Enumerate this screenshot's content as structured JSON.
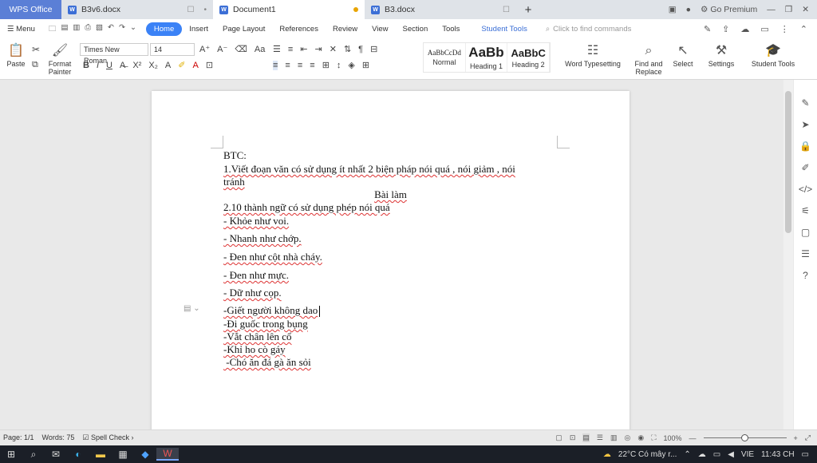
{
  "titlebar": {
    "app_tab": "WPS Office",
    "tabs": [
      {
        "label": "B3v6.docx"
      },
      {
        "label": "Document1"
      },
      {
        "label": "B3.docx"
      }
    ],
    "new_tab": "+",
    "go_premium": "Go Premium"
  },
  "ribbon_tabs": {
    "menu": "Menu",
    "items": [
      "Home",
      "Insert",
      "Page Layout",
      "References",
      "Review",
      "View",
      "Section",
      "Tools"
    ],
    "student_tools": "Student Tools",
    "search_placeholder": "Click to find commands"
  },
  "ribbon": {
    "paste": "Paste",
    "format_painter_1": "Format",
    "format_painter_2": "Painter",
    "font_name": "Times New Roman",
    "font_size": "14",
    "styles": [
      {
        "preview": "AaBbCcDd",
        "name": "Normal"
      },
      {
        "preview": "AaBb",
        "name": "Heading 1"
      },
      {
        "preview": "AaBbC",
        "name": "Heading 2"
      }
    ],
    "word_typesetting": "Word Typesetting",
    "find_replace_1": "Find and",
    "find_replace_2": "Replace",
    "select": "Select",
    "settings": "Settings",
    "student_tools": "Student Tools"
  },
  "document": {
    "lines": [
      "BTC:",
      "1.Viết đoạn văn có sử dụng ít nhất 2 biện pháp nói quá , nói giảm , nói",
      "tránh",
      "Bài làm",
      "2.10 thành ngữ có sử dụng phép nói quá",
      "- Khỏe như voi.",
      "- Nhanh như chớp.",
      "- Đen như cột nhà cháy.",
      "- Đen như mực.",
      "- Dữ như cọp.",
      "-Giết người không dao",
      "-Đi guốc trong bụng",
      "-Vắt chân lên cổ",
      "-Khỉ ho cò gáy",
      " -Chó ăn đá gà ăn sỏi"
    ]
  },
  "status": {
    "page": "Page: 1/1",
    "words": "Words: 75",
    "spell_check": "Spell Check",
    "zoom": "100%",
    "zoom_level": 0.5
  },
  "taskbar": {
    "weather": "22°C  Có mây r...",
    "lang": "VIE",
    "time": "11:43 CH"
  }
}
